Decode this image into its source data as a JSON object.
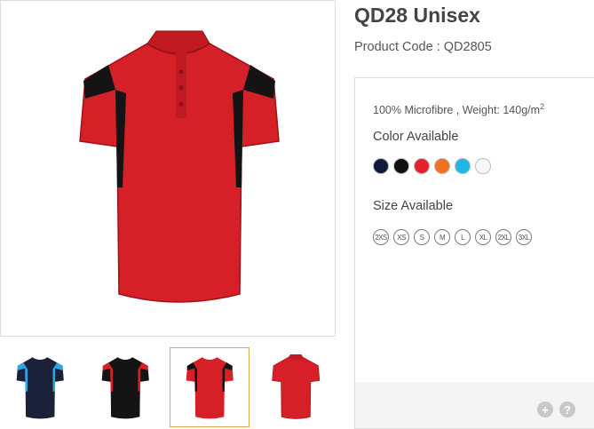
{
  "product": {
    "title": "QD28 Unisex",
    "code": "Product Code : QD2805",
    "material": "100% Microfibre , Weight: 140g/m",
    "material_sup": "2",
    "color_label": "Color Available",
    "size_label": "Size Available"
  },
  "colors": [
    "#0d1a3a",
    "#111111",
    "#e8202a",
    "#f2711f",
    "#1fb6e8",
    "#f7f7f7"
  ],
  "sizes": [
    "2XS",
    "XS",
    "S",
    "M",
    "L",
    "XL",
    "2XL",
    "3XL"
  ],
  "thumbnails": [
    {
      "body": "#1a2138",
      "accent": "#2aa7e0",
      "selected": false
    },
    {
      "body": "#141414",
      "accent": "#d62028",
      "selected": false
    },
    {
      "body": "#d62028",
      "accent": "#141414",
      "selected": true
    },
    {
      "body": "#d62028",
      "accent": "#d62028",
      "selected": false
    }
  ],
  "footer": {
    "plus": "+",
    "help": "?"
  }
}
